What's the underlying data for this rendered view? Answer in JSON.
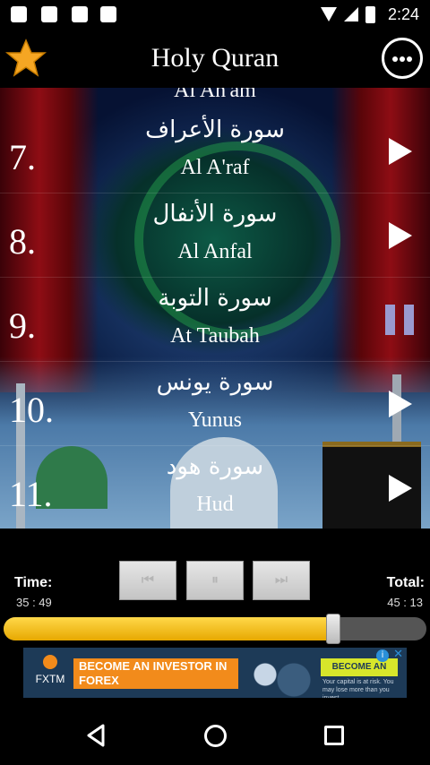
{
  "status_bar": {
    "time": "2:24",
    "icons": [
      "android-icon",
      "clipboard-check-icon",
      "clipboard-check-icon",
      "download-icon",
      "wifi-icon",
      "signal-icon",
      "battery-icon"
    ]
  },
  "header": {
    "title": "Holy Quran",
    "left_icon": "star-icon",
    "right_icon": "more-icon",
    "accent_star": "#f5a623"
  },
  "list": {
    "partial_top": "Al An'am",
    "rows": [
      {
        "number": "7.",
        "arabic": "سورة الأعراف",
        "english": "Al A'raf",
        "state": "play"
      },
      {
        "number": "8.",
        "arabic": "سورة الأنفال",
        "english": "Al Anfal",
        "state": "play"
      },
      {
        "number": "9.",
        "arabic": "سورة التوبة",
        "english": "At Taubah",
        "state": "pause"
      },
      {
        "number": "10.",
        "arabic": "سورة يونس",
        "english": "Yunus",
        "state": "play"
      },
      {
        "number": "11.",
        "arabic": "سورة هود",
        "english": "Hud",
        "state": "play"
      }
    ]
  },
  "player": {
    "time_label": "Time:",
    "time_value": "35 : 49",
    "total_label": "Total:",
    "total_value": "45 : 13",
    "progress": 0.78,
    "buttons": [
      {
        "name": "previous-button",
        "glyph": "⏮"
      },
      {
        "name": "pause-button",
        "glyph": "⏸"
      },
      {
        "name": "next-button",
        "glyph": "⏭"
      }
    ],
    "progress_color": "#f2b811"
  },
  "ad": {
    "brand": "FXTM",
    "headline": "BECOME AN INVESTOR IN FOREX",
    "cta": "BECOME AN INVESTOR",
    "risk": "Your capital is at risk. You may lose more than you invest.",
    "info": "i",
    "close": "✕"
  },
  "nav": {
    "back": "back-icon",
    "home": "home-icon",
    "recents": "recents-icon"
  }
}
